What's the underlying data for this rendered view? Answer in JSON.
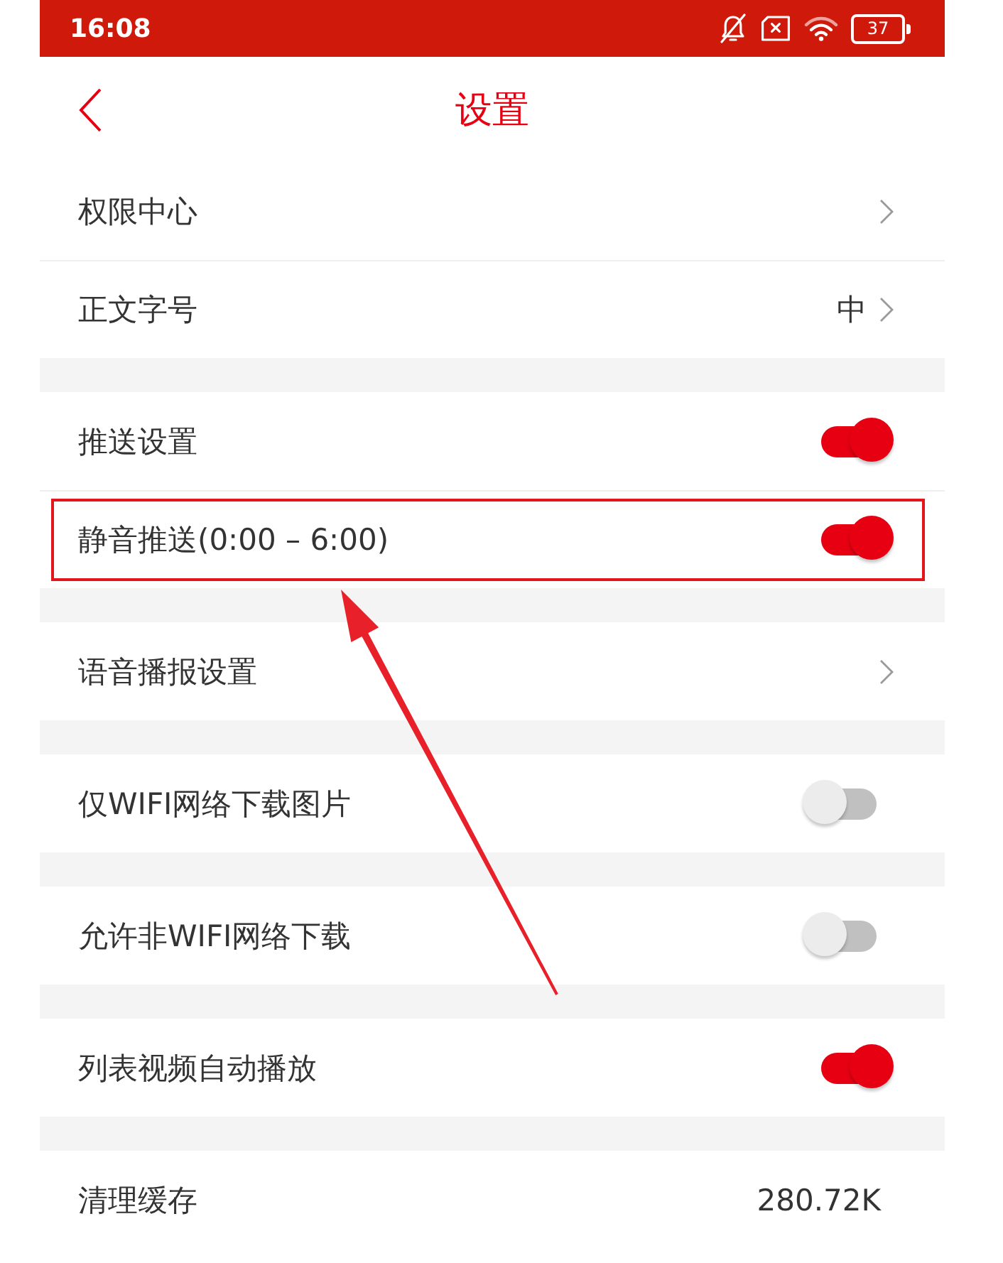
{
  "status_bar": {
    "time": "16:08",
    "battery": "37"
  },
  "header": {
    "title": "设置"
  },
  "sections": [
    {
      "rows": [
        {
          "kind": "link",
          "label": "权限中心",
          "highlighted": false
        },
        {
          "kind": "link",
          "label": "正文字号",
          "value": "中",
          "highlighted": false
        }
      ]
    },
    {
      "rows": [
        {
          "kind": "toggle",
          "label": "推送设置",
          "on": true,
          "highlighted": false
        },
        {
          "kind": "toggle",
          "label": "静音推送(0:00 – 6:00)",
          "on": true,
          "highlighted": true
        }
      ]
    },
    {
      "rows": [
        {
          "kind": "link",
          "label": "语音播报设置",
          "highlighted": false
        }
      ]
    },
    {
      "rows": [
        {
          "kind": "toggle",
          "label": "仅WIFI网络下载图片",
          "on": false,
          "highlighted": false
        }
      ]
    },
    {
      "rows": [
        {
          "kind": "toggle",
          "label": "允许非WIFI网络下载",
          "on": false,
          "highlighted": false
        }
      ]
    },
    {
      "rows": [
        {
          "kind": "toggle",
          "label": "列表视频自动播放",
          "on": true,
          "highlighted": false
        }
      ]
    },
    {
      "rows": [
        {
          "kind": "value",
          "label": "清理缓存",
          "value": "280.72K",
          "highlighted": false
        }
      ]
    }
  ]
}
